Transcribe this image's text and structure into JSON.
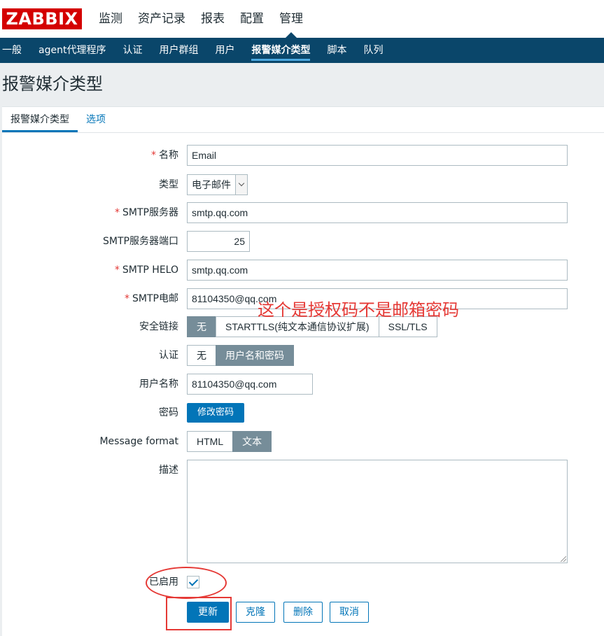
{
  "logo": "ZABBIX",
  "main_menu": [
    {
      "label": "监测",
      "active": false
    },
    {
      "label": "资产记录",
      "active": false
    },
    {
      "label": "报表",
      "active": false
    },
    {
      "label": "配置",
      "active": false
    },
    {
      "label": "管理",
      "active": true
    }
  ],
  "sub_menu": [
    {
      "label": "一般",
      "active": false
    },
    {
      "label": "agent代理程序",
      "active": false
    },
    {
      "label": "认证",
      "active": false
    },
    {
      "label": "用户群组",
      "active": false
    },
    {
      "label": "用户",
      "active": false
    },
    {
      "label": "报警媒介类型",
      "active": true
    },
    {
      "label": "脚本",
      "active": false
    },
    {
      "label": "队列",
      "active": false
    }
  ],
  "page_title": "报警媒介类型",
  "tabs": [
    {
      "label": "报警媒介类型",
      "active": true
    },
    {
      "label": "选项",
      "active": false
    }
  ],
  "form": {
    "name": {
      "label": "名称",
      "required": "*",
      "value": "Email"
    },
    "type": {
      "label": "类型",
      "value": "电子邮件"
    },
    "smtp_server": {
      "label": "SMTP服务器",
      "required": "*",
      "value": "smtp.qq.com"
    },
    "smtp_port": {
      "label": "SMTP服务器端口",
      "value": "25"
    },
    "smtp_helo": {
      "label": "SMTP HELO",
      "required": "*",
      "value": "smtp.qq.com"
    },
    "smtp_email": {
      "label": "SMTP电邮",
      "required": "*",
      "value": "81104350@qq.com"
    },
    "security": {
      "label": "安全链接",
      "options": [
        "无",
        "STARTTLS(纯文本通信协议扩展)",
        "SSL/TLS"
      ],
      "selected": "无"
    },
    "auth": {
      "label": "认证",
      "options": [
        "无",
        "用户名和密码"
      ],
      "selected": "用户名和密码"
    },
    "username": {
      "label": "用户名称",
      "value": "81104350@qq.com"
    },
    "password": {
      "label": "密码",
      "button": "修改密码"
    },
    "message_format": {
      "label": "Message format",
      "options": [
        "HTML",
        "文本"
      ],
      "selected": "文本"
    },
    "description": {
      "label": "描述",
      "value": ""
    },
    "enabled": {
      "label": "已启用",
      "checked": true
    }
  },
  "annotation": "这个是授权码不是邮箱密码",
  "buttons": {
    "update": "更新",
    "clone": "克隆",
    "delete": "删除",
    "cancel": "取消"
  },
  "colors": {
    "logo_bg": "#d40000",
    "subnav_bg": "#0a466a",
    "primary": "#0275b8",
    "segment_active": "#768d99",
    "annotation": "#e53935"
  }
}
